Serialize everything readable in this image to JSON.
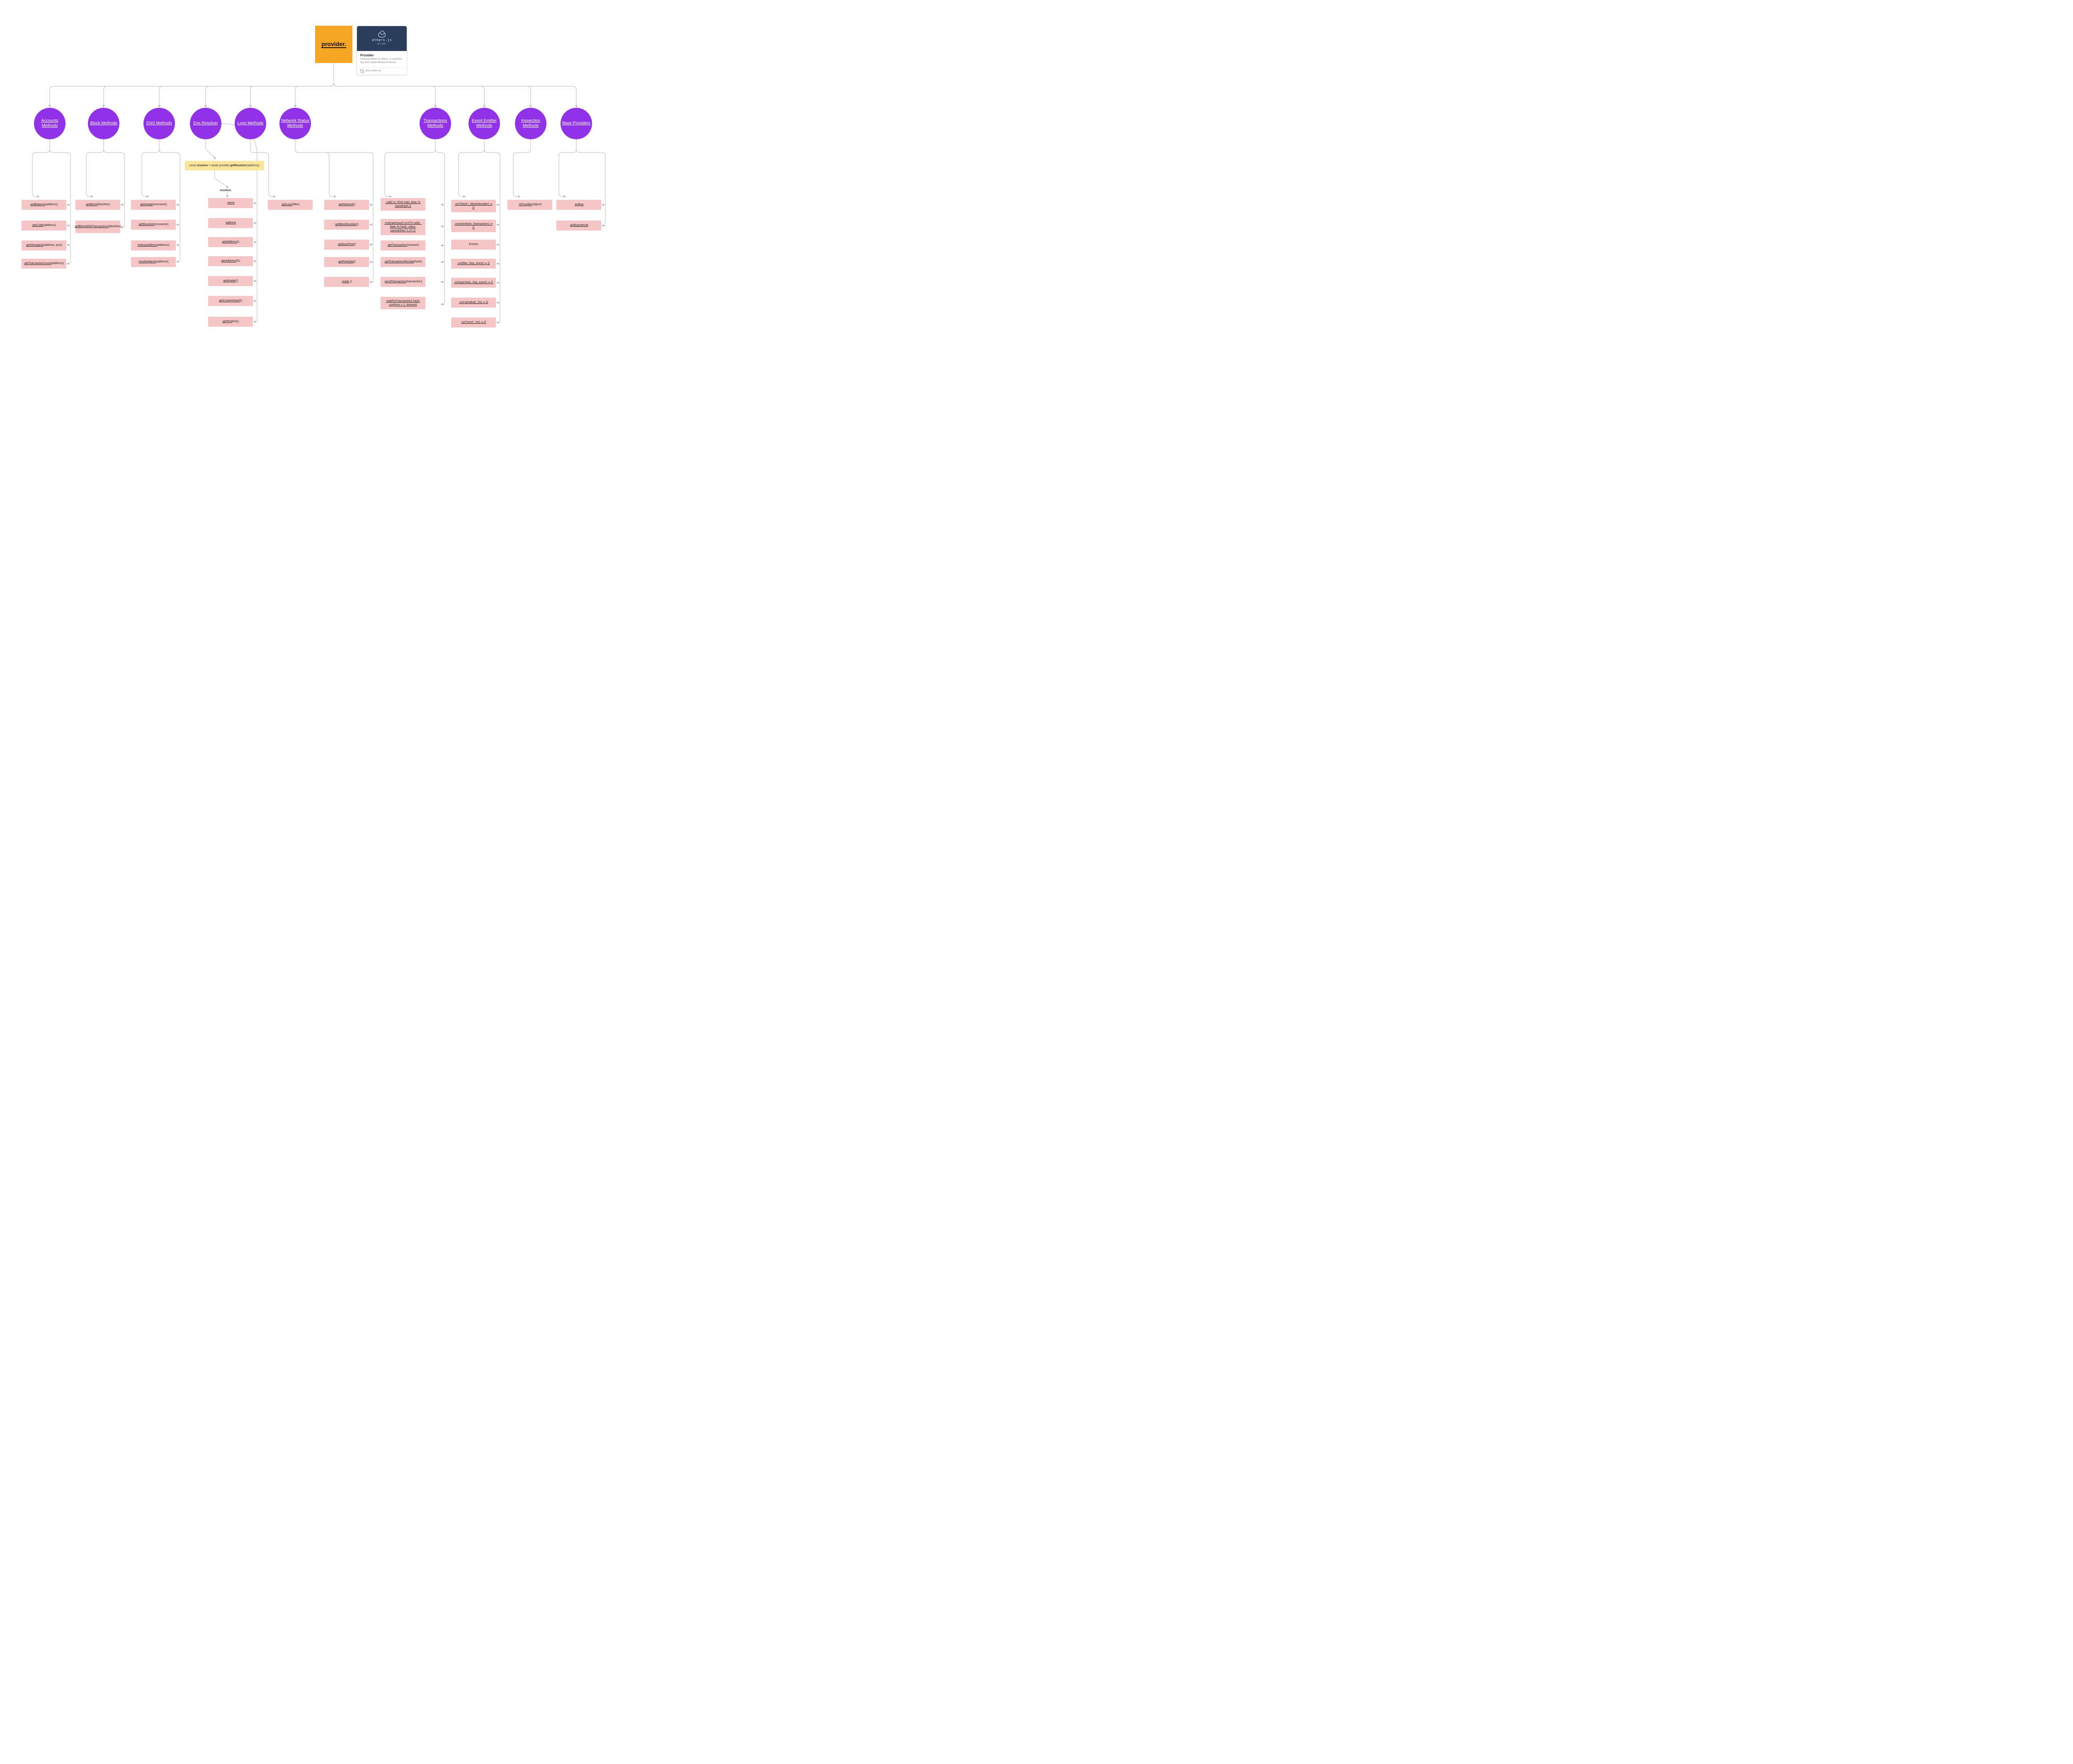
{
  "root": {
    "title": "provider."
  },
  "info": {
    "thumb_t1": "ethers.js",
    "thumb_t2": "@ricmoo",
    "title": "Provider",
    "desc": "Documentation for ethers, a complete, tiny and simple Ethereum library.",
    "domain": "docs.ethers.io"
  },
  "categories": {
    "accounts": "Accounts Methods",
    "block": "Block Methods",
    "ens": "ENS Methods",
    "resolver": "Ens Resolver",
    "logs": "Logs Methods",
    "network": "Network Status Methods",
    "txns": "Transactions Methods",
    "events": "Event Emitter Methods",
    "inspect": "Inspection Methods",
    "base": "Base Providers"
  },
  "note": {
    "resolver_decl": "const resolver = await provider.getResolver(address);"
  },
  "labels": {
    "resolver_prefix": "resolver."
  },
  "methods": {
    "accounts": [
      {
        "pre": ".",
        "m": "getBalance",
        "args": "(address);"
      },
      {
        "pre": ".",
        "m": "getCode",
        "args": "(address);"
      },
      {
        "pre": ".",
        "m": "getStorageAt",
        "args": "(address, pos);"
      },
      {
        "pre": ".",
        "m": "getTransactionCount",
        "args": "(address);"
      }
    ],
    "block": [
      {
        "pre": ".",
        "m": "getBlock",
        "args": "(blockNo);"
      },
      {
        "pre": ".",
        "m": "getBlockWithTransactions",
        "args": "(blockNo);"
      }
    ],
    "ens": [
      {
        "pre": ".",
        "m": "getAvatar",
        "args": "(ensname);"
      },
      {
        "pre": ".",
        "m": "getResolver",
        "args": "(ensname);"
      },
      {
        "pre": ".",
        "m": "lookupAddress",
        "args": "(address);"
      },
      {
        "pre": ".",
        "m": "resolveName",
        "args": "(address);"
      }
    ],
    "resolver": [
      {
        "pre": ".",
        "m": "name",
        "args": ""
      },
      {
        "pre": ".",
        "m": "address",
        "args": ""
      },
      {
        "pre": ".",
        "m": "getAddress",
        "args": "();"
      },
      {
        "pre": ".",
        "m": "getAddress",
        "args": "(0);"
      },
      {
        "pre": ".",
        "m": "getAvatar",
        "args": "();"
      },
      {
        "pre": ".",
        "m": "getContentHash",
        "args": "();"
      },
      {
        "pre": ".",
        "m": "getText",
        "args": "(key);"
      }
    ],
    "logs": [
      {
        "pre": ".",
        "m": "getLogs",
        "args": "(filter)"
      }
    ],
    "network": [
      {
        "pre": ".",
        "m": "getNetwork",
        "args": "()"
      },
      {
        "pre": ".",
        "m": "getBlockNumber",
        "args": "()"
      },
      {
        "pre": ".",
        "m": "getGasPrice",
        "args": "()"
      },
      {
        "pre": ".",
        "m": "getFeeData",
        "args": "()"
      },
      {
        "pre": ".",
        "m": "ready",
        "args": " ()"
      }
    ],
    "txns": [
      {
        "text": ".call({ to: ENS Add, data: fn namehash })"
      },
      {
        "text": ".estimateGas({ to:ETH addr ,  data: fn hash,  value: parseEther(\"1.0\") })"
      },
      {
        "pre": ".",
        "m": "getTransaction",
        "args": "(txnhash)"
      },
      {
        "pre": ".",
        "m": "getTransactionReceipt",
        "args": "(hash)"
      },
      {
        "pre": ".",
        "m": "sendTransaction",
        "args": "(transaction)"
      },
      {
        "text": ".waitForTransaction( hash, confirms = 1, timeout)"
      }
    ],
    "events": [
      {
        "text": ".on(\"block\", (blockNumber) ⇒ {}"
      },
      {
        "text": ".once(txHash, (transaction) ⇒ {}"
      },
      {
        "text": "Events"
      },
      {
        "text": ".on(filter, (log, event) ⇒ {}"
      },
      {
        "text": ".on(topicSets, (log, event) ⇒ {}"
      },
      {
        "text": ".on(\"pending\", (tx) ⇒ {}"
      },
      {
        "text": ".on(\"error\", (tx) ⇒ {}"
      }
    ],
    "inspect": [
      {
        "pre": ".",
        "m": "isProvider",
        "args": "(object)"
      }
    ],
    "base": [
      {
        "pre": ".",
        "m": "polling",
        "args": ""
      },
      {
        "pre": ".",
        "m": "pollingInterval",
        "args": ""
      }
    ]
  }
}
